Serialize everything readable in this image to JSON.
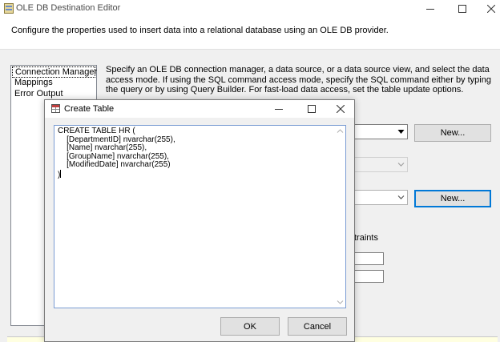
{
  "main_window": {
    "title": "OLE DB Destination Editor",
    "description": "Configure the properties used to insert data into a relational database using an OLE DB provider.",
    "nav_items": [
      "Connection Manager",
      "Mappings",
      "Error Output"
    ],
    "instructions": "Specify an OLE DB connection manager, a data source, or a data source view, and select the data access mode. If using the SQL command access mode, specify the SQL command either by typing the query or by using Query Builder. For fast-load data access, set the table update options.",
    "new_button_1": "New...",
    "new_button_2": "New...",
    "constraints_label": "traints"
  },
  "dialog": {
    "title": "Create Table",
    "sql_text": "CREATE TABLE HR (\n    [DepartmentID] nvarchar(255),\n    [Name] nvarchar(255),\n    [GroupName] nvarchar(255),\n    [ModifiedDate] nvarchar(255)\n)",
    "ok_label": "OK",
    "cancel_label": "Cancel"
  },
  "colors": {
    "focus_border": "#0078d7",
    "window_bg": "#f0f0f0",
    "status_bar": "#ffffe1"
  }
}
